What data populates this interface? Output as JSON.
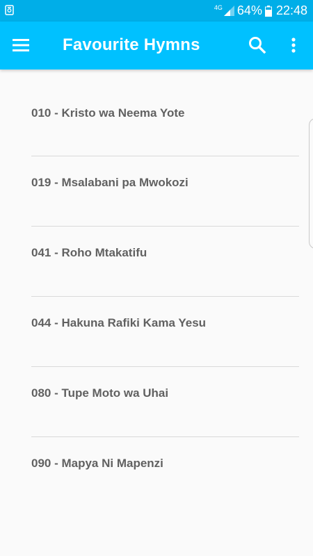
{
  "status_bar": {
    "network": "4G",
    "battery_percent": "64%",
    "time": "22:48"
  },
  "app_bar": {
    "title": "Favourite Hymns"
  },
  "hymns": [
    {
      "label": "010 - Kristo wa Neema Yote"
    },
    {
      "label": "019 - Msalabani pa Mwokozi"
    },
    {
      "label": "041 - Roho Mtakatifu"
    },
    {
      "label": "044 - Hakuna Rafiki Kama Yesu"
    },
    {
      "label": "080 - Tupe Moto wa Uhai"
    },
    {
      "label": "090 - Mapya Ni Mapenzi"
    }
  ],
  "colors": {
    "status_bar": "#00aee8",
    "app_bar": "#00c1ff",
    "list_text": "#616161",
    "divider": "#d9d9d9",
    "background": "#fafafa"
  },
  "icons": {
    "status_left": "screenshot-notification-icon",
    "signal": "signal-icon",
    "battery": "battery-icon",
    "menu": "hamburger-menu-icon",
    "search": "search-icon",
    "more": "more-vert-icon"
  }
}
